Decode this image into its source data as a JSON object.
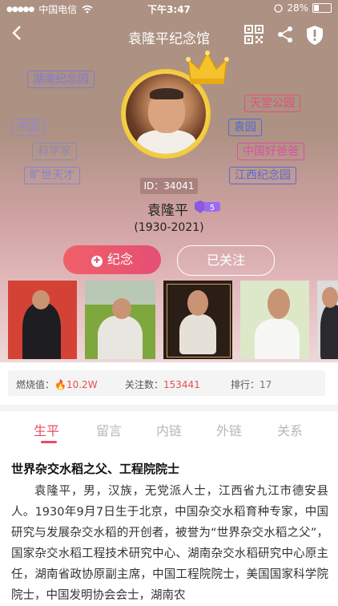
{
  "status_bar": {
    "carrier": "中国电信",
    "time": "下午3:47",
    "battery": "28%"
  },
  "nav": {
    "title": "袁隆平纪念馆",
    "back_icon": "chevron-left",
    "qr_icon": "qr-code",
    "share_icon": "share",
    "report_icon": "shield-alert"
  },
  "tags": [
    "湖南纪念园",
    "中国",
    "科学家",
    "旷世天才",
    "天堂公园",
    "袁园",
    "中国好爸爸",
    "江西纪念园"
  ],
  "profile": {
    "id_text": "ID：34041",
    "name": "袁隆平",
    "level": "5",
    "years": "(1930-2021)"
  },
  "buttons": {
    "memorial": "纪念",
    "follow": "已关注"
  },
  "stats": {
    "burn_label": "燃烧值：",
    "burn_value": "10.2W",
    "followers_label": "关注数：",
    "followers_value": "153441",
    "rank_label": "排行：",
    "rank_value": "17"
  },
  "tabs": [
    "生平",
    "留言",
    "内链",
    "外链",
    "关系"
  ],
  "bio": {
    "title": "世界杂交水稻之父、工程院院士",
    "text": "袁隆平，男，汉族，无党派人士，江西省九江市德安县人。1930年9月7日生于北京，中国杂交水稻育种专家，中国研究与发展杂交水稻的开创者，被誉为“世界杂交水稻之父”，国家杂交水稻工程技术研究中心、湖南杂交水稻研究中心原主任，湖南省政协原副主席，中国工程院院士，美国国家科学院院士，中国发明协会会士，湖南农"
  },
  "colors": {
    "accent": "#e54f5f",
    "hero_top": "#ad9182",
    "hero_bottom": "#efd7d8"
  }
}
